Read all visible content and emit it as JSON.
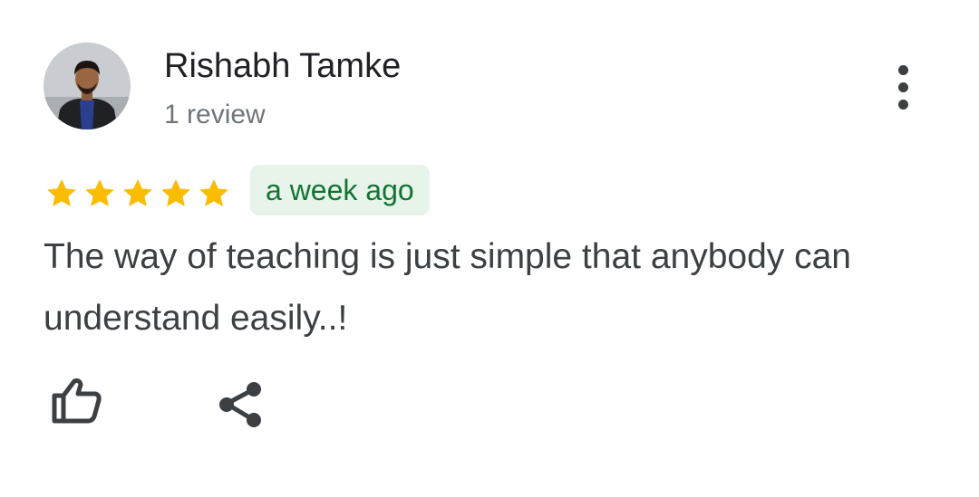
{
  "reviewer": {
    "name": "Rishabh Tamke",
    "review_count": "1 review",
    "avatar_icon": "profile-photo"
  },
  "review": {
    "rating": 5,
    "rating_max": 5,
    "star_color": "#fbbc04",
    "date": "a week ago",
    "text": "The way of teaching is just simple that anybody can understand easily..!"
  },
  "colors": {
    "badge_bg": "#e6f4ea",
    "badge_text": "#137333",
    "name_text": "#202124",
    "body_text": "#3c4043",
    "secondary_text": "#70757a"
  },
  "actions": {
    "more_icon": "more-vert-icon",
    "like_icon": "thumbs-up-icon",
    "share_icon": "share-icon"
  }
}
